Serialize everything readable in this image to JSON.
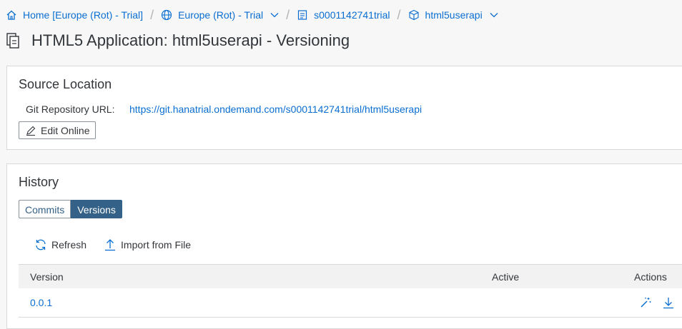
{
  "breadcrumb": {
    "home": "Home [Europe (Rot) - Trial]",
    "region": "Europe (Rot) - Trial",
    "account": "s0001142741trial",
    "app": "html5userapi"
  },
  "page": {
    "title": "HTML5 Application: html5userapi - Versioning"
  },
  "source": {
    "title": "Source Location",
    "git_label": "Git Repository URL:",
    "git_url": "https://git.hanatrial.ondemand.com/s0001142741trial/html5userapi",
    "edit_label": "Edit Online"
  },
  "history": {
    "title": "History",
    "tabs": {
      "commits": "Commits",
      "versions": "Versions"
    },
    "toolbar": {
      "refresh": "Refresh",
      "import": "Import from File"
    },
    "columns": {
      "version": "Version",
      "active": "Active",
      "actions": "Actions"
    },
    "rows": [
      {
        "version": "0.0.1",
        "active": ""
      }
    ]
  },
  "colors": {
    "accent": "#0a6ed1",
    "selected_tab": "#346187"
  }
}
